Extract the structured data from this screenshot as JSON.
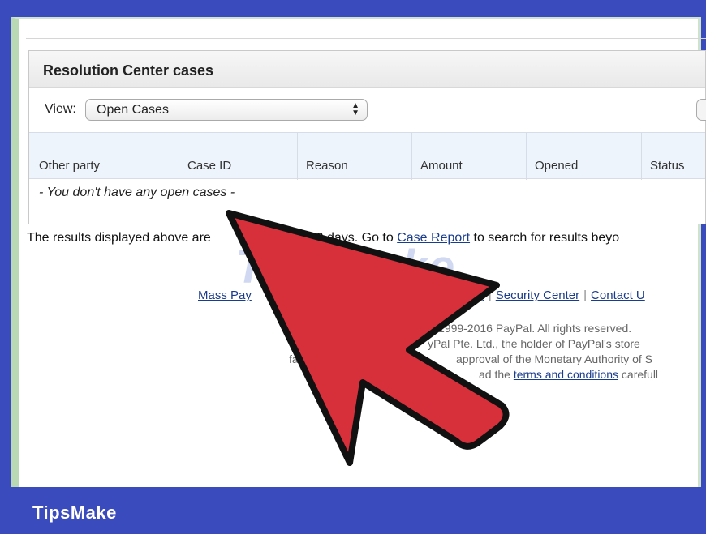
{
  "resolution": {
    "title": "Resolution Center cases",
    "view_label": "View:",
    "view_selected": "Open Cases",
    "columns": [
      "Other party",
      "Case ID",
      "Reason",
      "Amount",
      "Opened",
      "Status"
    ],
    "empty_message": "- You don't have any open cases -"
  },
  "notice": {
    "prefix": "The results displayed above are",
    "days": "180",
    "middle": " days. Go to ",
    "link": "Case Report",
    "suffix": " to search for results beyo"
  },
  "footer": {
    "links": [
      "Mass Pay",
      "cy",
      "Security Center",
      "Contact U"
    ],
    "copyright_lines": [
      "1999-2016 PayPal. All rights reserved.",
      "yPal Pte. Ltd., the holder of PayPal's store",
      "approval of the Monetary Authority of S",
      "ad the"
    ],
    "fac_fragment": "fac",
    "terms_link": "terms and conditions",
    "terms_suffix": " carefull"
  },
  "watermark": {
    "text": "TipsMake",
    "domain": ".com"
  },
  "brand": {
    "name": "TipsMake"
  },
  "colors": {
    "frame": "#3a4bbd",
    "arrow_fill": "#d7303b",
    "arrow_stroke": "#111111",
    "link": "#1a3c8c"
  }
}
